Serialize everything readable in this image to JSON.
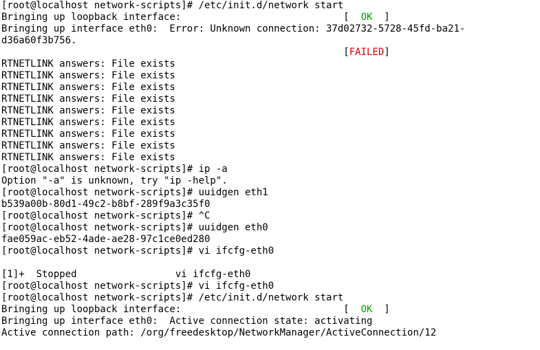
{
  "prompt": "[root@localhost network-scripts]# ",
  "cmd": {
    "netstart": "/etc/init.d/network start",
    "ipa": "ip -a",
    "uuidgen_eth1": "uuidgen eth1",
    "ctrl_c": "^C",
    "uuidgen_eth0": "uuidgen eth0",
    "vi_ifcfg": "vi ifcfg-eth0"
  },
  "loopback_line": "Bringing up loopback interface:                            ",
  "bracket_open": "[  ",
  "bracket_close": "  ]",
  "ok": "OK",
  "failed": "FAILED",
  "failed_bracket_open": "[",
  "failed_bracket_close": "]",
  "eth0_error_l1": "Bringing up interface eth0:  Error: Unknown connection: 37d02732-5728-45fd-ba21-",
  "eth0_error_l2": "d36a60f3b756.",
  "failed_pad": "                                                           ",
  "rtnetlink": "RTNETLINK answers: File exists",
  "ip_help": "Option \"-a\" is unknown, try \"ip -help\".",
  "uuid_eth1": "b539a00b-80d1-49c2-b8bf-289f9a3c35f0",
  "uuid_eth0": "fae059ac-eb52-4ade-ae28-97c1ce0ed280",
  "blank": "",
  "stopped_job": "[1]+  Stopped                 vi ifcfg-eth0",
  "eth0_active_l1": "Bringing up interface eth0:  Active connection state: activating",
  "eth0_active_l2": "Active connection path: /org/freedesktop/NetworkManager/ActiveConnection/12"
}
